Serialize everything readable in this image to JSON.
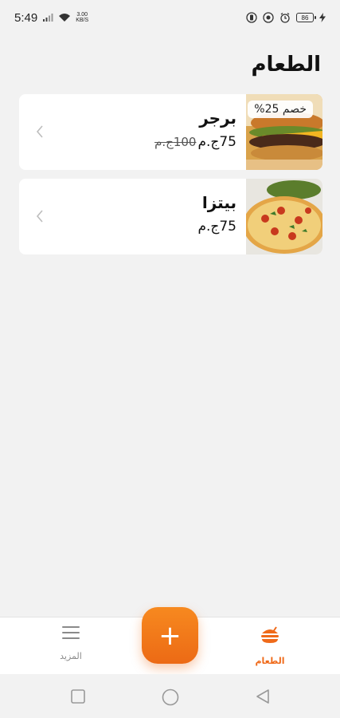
{
  "status_bar": {
    "time": "5:49",
    "net_speed_value": "3.00",
    "net_speed_unit": "KB/S",
    "battery": "86"
  },
  "page": {
    "title": "الطعام"
  },
  "items": [
    {
      "name": "برجر",
      "price": "75ج.م",
      "old_price": "100ج.م",
      "discount": "خصم 25%",
      "image_icon": "burger-photo"
    },
    {
      "name": "بيتزا",
      "price": "75ج.م",
      "image_icon": "pizza-photo"
    }
  ],
  "bottom_nav": {
    "food_label": "الطعام",
    "more_label": "المزيد",
    "add_label": "+"
  },
  "colors": {
    "accent": "#ef6a1a",
    "background": "#f2f2f2",
    "card": "#ffffff"
  }
}
